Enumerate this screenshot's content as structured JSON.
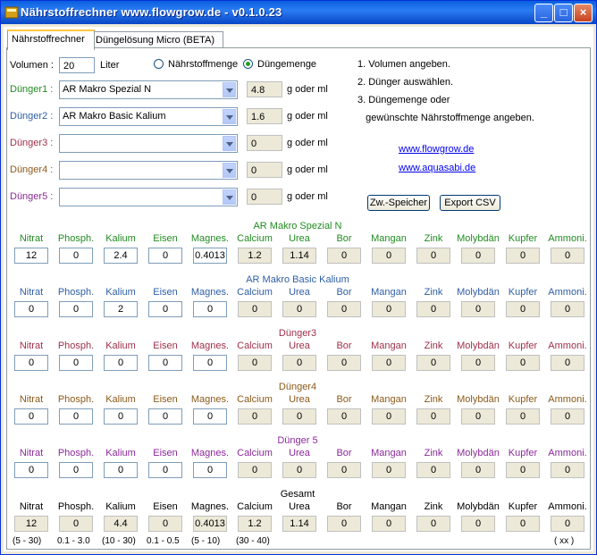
{
  "window": {
    "title": "Nährstoffrechner www.flowgrow.de - v0.1.0.23",
    "minimize": "_",
    "maximize": "□",
    "close": "×"
  },
  "tabs": [
    {
      "label": "Nährstoffrechner",
      "active": true
    },
    {
      "label": "Düngelösung Micro (BETA)",
      "active": false
    }
  ],
  "volume": {
    "label": "Volumen :",
    "value": "20",
    "unit": "Liter"
  },
  "mode": {
    "option1": "Nährstoffmenge",
    "option2": "Düngemenge",
    "selected": "Düngemenge"
  },
  "fertilizers": [
    {
      "label": "Dünger1 :",
      "product": "AR Makro Spezial N",
      "amount": "4.8",
      "unit": "g oder ml",
      "color": "#228b22"
    },
    {
      "label": "Dünger2 :",
      "product": "AR Makro Basic Kalium",
      "amount": "1.6",
      "unit": "g oder ml",
      "color": "#2f5fa6"
    },
    {
      "label": "Dünger3 :",
      "product": "",
      "amount": "0",
      "unit": "g oder ml",
      "color": "#a0304a"
    },
    {
      "label": "Dünger4 :",
      "product": "",
      "amount": "0",
      "unit": "g oder ml",
      "color": "#8b5a1a"
    },
    {
      "label": "Dünger5 :",
      "product": "",
      "amount": "0",
      "unit": "g oder ml",
      "color": "#8b2a9a"
    }
  ],
  "instructions": [
    "1. Volumen angeben.",
    "2. Dünger auswählen.",
    "3. Düngemenge oder",
    "   gewünschte Nährstoffmenge angeben."
  ],
  "links": [
    "www.flowgrow.de",
    "www.aquasabi.de"
  ],
  "buttons": {
    "store": "Zw.-Speicher",
    "export": "Export CSV"
  },
  "nutrient_columns": [
    "Nitrat",
    "Phosph.",
    "Kalium",
    "Eisen",
    "Magnes.",
    "Calcium",
    "Urea",
    "Bor",
    "Mangan",
    "Zink",
    "Molybdän",
    "Kupfer",
    "Ammoni."
  ],
  "sections": [
    {
      "heading": "AR Makro Spezial N",
      "color": "#228b22",
      "values": [
        "12",
        "0",
        "2.4",
        "0",
        "0.4013",
        "1.2",
        "1.14",
        "0",
        "0",
        "0",
        "0",
        "0",
        "0"
      ]
    },
    {
      "heading": "AR Makro Basic Kalium",
      "color": "#2f5fa6",
      "values": [
        "0",
        "0",
        "2",
        "0",
        "0",
        "0",
        "0",
        "0",
        "0",
        "0",
        "0",
        "0",
        "0"
      ]
    },
    {
      "heading": "Dünger3",
      "color": "#a0304a",
      "values": [
        "0",
        "0",
        "0",
        "0",
        "0",
        "0",
        "0",
        "0",
        "0",
        "0",
        "0",
        "0",
        "0"
      ]
    },
    {
      "heading": "Dünger4",
      "color": "#8b5a1a",
      "values": [
        "0",
        "0",
        "0",
        "0",
        "0",
        "0",
        "0",
        "0",
        "0",
        "0",
        "0",
        "0",
        "0"
      ]
    },
    {
      "heading": "Dünger 5",
      "color": "#8b2a9a",
      "values": [
        "0",
        "0",
        "0",
        "0",
        "0",
        "0",
        "0",
        "0",
        "0",
        "0",
        "0",
        "0",
        "0"
      ]
    },
    {
      "heading": "Gesamt",
      "color": "#000000",
      "values": [
        "12",
        "0",
        "4.4",
        "0",
        "0.4013",
        "1.2",
        "1.14",
        "0",
        "0",
        "0",
        "0",
        "0",
        "0"
      ]
    }
  ],
  "ranges": [
    "(5 - 30)",
    "0.1 - 3.0",
    "(10 - 30)",
    "0.1 - 0.5",
    "(5 - 10)",
    "(30 - 40)",
    "",
    "",
    "",
    "",
    "",
    "",
    "( xx )"
  ]
}
